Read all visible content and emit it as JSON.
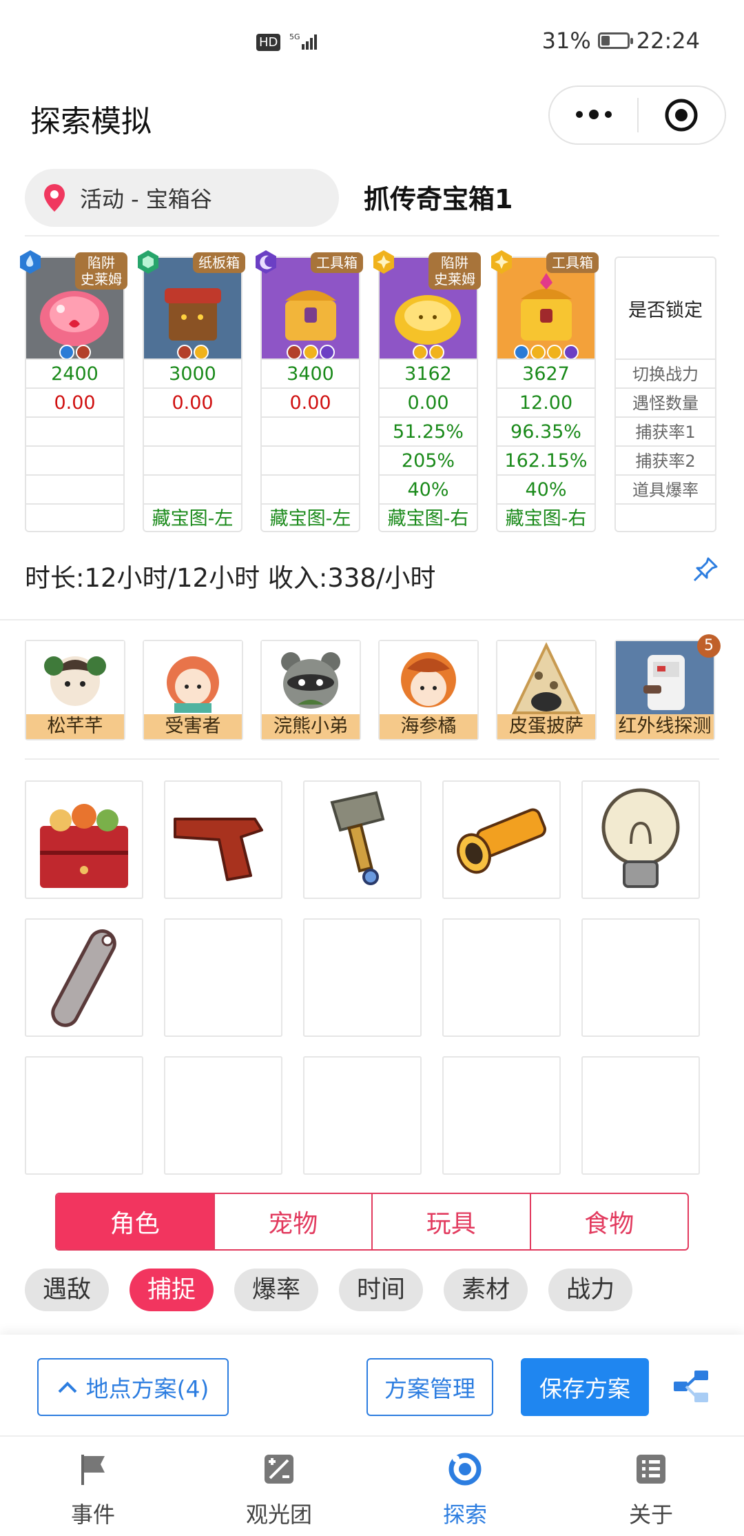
{
  "status_bar": {
    "network": "5G",
    "hd": "HD",
    "battery": "31%",
    "time": "22:24"
  },
  "header": {
    "title": "探索模拟"
  },
  "location": {
    "label": "活动 - 宝箱谷"
  },
  "plan_title": "抓传奇宝箱1",
  "monsters": [
    {
      "tag": "陷阱\n史莱姆",
      "power": "2400",
      "count": "0.00",
      "capture1": "",
      "capture2": "",
      "drop": "",
      "map": ""
    },
    {
      "tag": "纸板箱",
      "power": "3000",
      "count": "0.00",
      "capture1": "",
      "capture2": "",
      "drop": "",
      "map": "藏宝图-左"
    },
    {
      "tag": "工具箱",
      "power": "3400",
      "count": "0.00",
      "capture1": "",
      "capture2": "",
      "drop": "",
      "map": "藏宝图-左"
    },
    {
      "tag": "陷阱\n史莱姆",
      "power": "3162",
      "count": "0.00",
      "capture1": "51.25%",
      "capture2": "205%",
      "drop": "40%",
      "map": "藏宝图-右"
    },
    {
      "tag": "工具箱",
      "power": "3627",
      "count": "12.00",
      "capture1": "96.35%",
      "capture2": "162.15%",
      "drop": "40%",
      "map": "藏宝图-右"
    }
  ],
  "row_labels": {
    "lock": "是否锁定",
    "power": "切换战力",
    "count": "遇怪数量",
    "capture1": "捕获率1",
    "capture2": "捕获率2",
    "drop": "道具爆率"
  },
  "summary": "时长:12小时/12小时 收入:338/小时",
  "characters": [
    {
      "name": "松芊芊"
    },
    {
      "name": "受害者"
    },
    {
      "name": "浣熊小弟"
    },
    {
      "name": "海参橘"
    },
    {
      "name": "皮蛋披萨"
    },
    {
      "name": "红外线探测",
      "badge": "5"
    }
  ],
  "tabs": [
    "角色",
    "宠物",
    "玩具",
    "食物"
  ],
  "filters": [
    "遇敌",
    "捕捉",
    "爆率",
    "时间",
    "素材",
    "战力"
  ],
  "footer": {
    "plans_btn": "地点方案(4)",
    "manage_btn": "方案管理",
    "save_btn": "保存方案"
  },
  "nav": [
    {
      "label": "事件",
      "icon": "flag-icon"
    },
    {
      "label": "观光团",
      "icon": "tour-icon"
    },
    {
      "label": "探索",
      "icon": "explore-icon"
    },
    {
      "label": "关于",
      "icon": "about-icon"
    }
  ],
  "colors": {
    "accent": "#f2355f",
    "blue": "#1f86f0",
    "green": "#1a8a1a",
    "red": "#d01010"
  }
}
